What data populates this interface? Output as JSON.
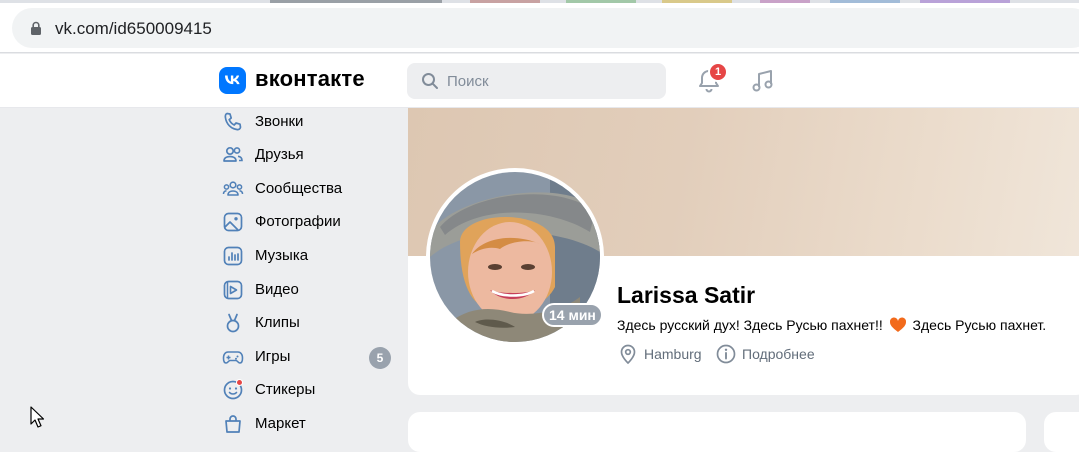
{
  "browser": {
    "url": "vk.com/id650009415"
  },
  "header": {
    "logo_text": "вконтакте",
    "search_placeholder": "Поиск",
    "notification_count": "1"
  },
  "sidebar": {
    "items": [
      {
        "label": "Звонки",
        "icon": "phone-icon"
      },
      {
        "label": "Друзья",
        "icon": "friends-icon"
      },
      {
        "label": "Сообщества",
        "icon": "communities-icon"
      },
      {
        "label": "Фотографии",
        "icon": "photos-icon"
      },
      {
        "label": "Музыка",
        "icon": "music-icon"
      },
      {
        "label": "Видео",
        "icon": "video-icon"
      },
      {
        "label": "Клипы",
        "icon": "clips-icon"
      },
      {
        "label": "Игры",
        "icon": "games-icon",
        "count": "5"
      },
      {
        "label": "Стикеры",
        "icon": "stickers-icon"
      },
      {
        "label": "Маркет",
        "icon": "market-icon"
      }
    ]
  },
  "profile": {
    "name": "Larissa Satir",
    "online": "14 мин",
    "status_before": "Здесь русский дух! Здесь Русью пахнет!!",
    "status_after": "Здесь Русью пахнет.",
    "city": "Hamburg",
    "more_label": "Подробнее"
  },
  "colors": {
    "accent": "#0077ff",
    "badge": "#e64646",
    "muted": "#99a2ad"
  }
}
